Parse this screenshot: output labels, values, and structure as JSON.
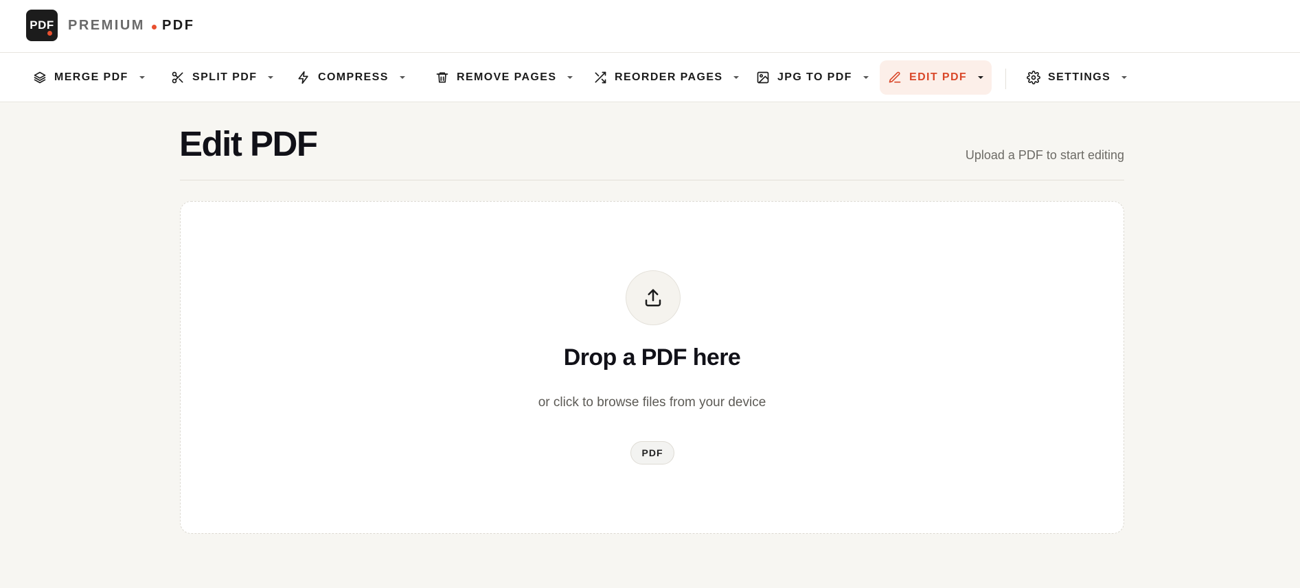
{
  "brand": {
    "logo_text": "PDF",
    "name_part1": "PREMIUM",
    "name_part2": "PDF",
    "accent_color": "#e8502f"
  },
  "nav": {
    "items": [
      {
        "label": "MERGE PDF",
        "icon": "layers-icon",
        "active": false
      },
      {
        "label": "SPLIT PDF",
        "icon": "scissors-icon",
        "active": false
      },
      {
        "label": "COMPRESS",
        "icon": "lightning-icon",
        "active": false
      },
      {
        "label": "REMOVE PAGES",
        "icon": "trash-icon",
        "active": false
      },
      {
        "label": "REORDER PAGES",
        "icon": "shuffle-icon",
        "active": false
      },
      {
        "label": "JPG TO PDF",
        "icon": "image-icon",
        "active": false
      },
      {
        "label": "EDIT PDF",
        "icon": "pen-icon",
        "active": true
      },
      {
        "label": "SETTINGS",
        "icon": "gear-icon",
        "active": false
      }
    ]
  },
  "page": {
    "title": "Edit PDF",
    "hint": "Upload a PDF to start editing"
  },
  "dropzone": {
    "icon": "upload-icon",
    "title": "Drop a PDF here",
    "subtitle": "or click to browse files from your device",
    "format_chip": "PDF"
  }
}
